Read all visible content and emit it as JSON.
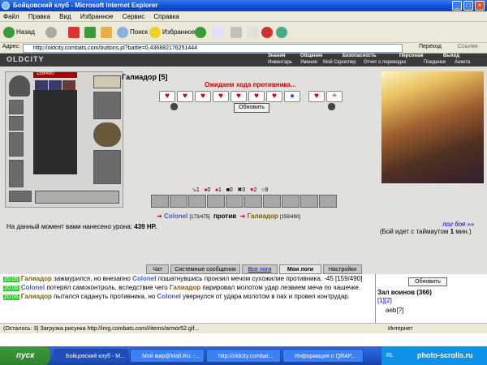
{
  "window": {
    "title": "Бойцовский клуб - Microsoft Internet Explorer",
    "min": "_",
    "max": "□",
    "close": "×"
  },
  "menu": [
    "Файл",
    "Правка",
    "Вид",
    "Избранное",
    "Сервис",
    "Справка"
  ],
  "toolbar": {
    "back": "Назад",
    "search": "Поиск",
    "favorites": "Избранное"
  },
  "address": {
    "label": "Адрес:",
    "url": "http://oldcity.combats.com/buttons.pl?battle=0.436882176251444",
    "go": "Переход",
    "links": "Ссылки"
  },
  "site": {
    "logo": "OLDCITY",
    "nav_top": [
      "Знания",
      "Общение",
      "Безопасность",
      "Персонаж",
      "Выход"
    ],
    "nav_bottom": [
      "Инвентарь",
      "Умения",
      "Мой Скроллер",
      "Отчет о переводах",
      "Поединки",
      "Анкета"
    ]
  },
  "character": {
    "hp": "159/490"
  },
  "battle": {
    "opponent_name": "Галиадор [5]",
    "waiting": "Ожидаем хода противника...",
    "refresh": "Обновить",
    "stats": [
      "1",
      "0",
      "1",
      "0",
      "0",
      "2",
      "9"
    ],
    "fighter1": "Colonel",
    "fighter1_hp": "[173/475]",
    "vs": "против",
    "fighter2": "Галиадор",
    "fighter2_hp": "[159/490]",
    "damage_label": "На данный момент вами нанесено урона:",
    "damage_value": "439 HP.",
    "log_link": "лог боя »»",
    "timeout": "(Бой идет с таймаутом",
    "timeout_value": "1",
    "timeout_unit": "мин.)"
  },
  "chat": {
    "tabs": [
      "Чат",
      "Системные сообщения",
      "Все логи",
      "Мои логи",
      "Настройки"
    ],
    "lines": [
      {
        "time": "20:05",
        "name": "Галиадор",
        "text": " зажмурился, но внезапно ",
        "name2": "Colonel",
        "text2": " пошатнувшись пронзил мечом сухожилие противника. -45 [159/490]"
      },
      {
        "time": "20:05",
        "name": "Colonel",
        "text": " потерял самоконтроль, вследствие чего ",
        "name2": "Галиадор",
        "text2": " парировал молотом удар лезвием меча по чашечке."
      },
      {
        "time": "20:05",
        "name": "Галиадор",
        "text": " пытался садануть противника, но ",
        "name2": "Colonel",
        "text2": " увернулся от удара молотом в пах и провел контрудар."
      }
    ]
  },
  "side": {
    "refresh": "Обновить",
    "hall": "Зал воинов (366)",
    "pages": "[1][2]",
    "user": "aeb[?]"
  },
  "status": {
    "text": "(Осталось: 3) Загрузка рисунка http://img.combats.com/i/items/armor52.gif...",
    "zone": "Интернет"
  },
  "taskbar": {
    "start": "пуск",
    "tasks": [
      "Бойцовский клуб - M...",
      "Мой мир@Mail.Ru: -...",
      "http://oldcity.combat...",
      "Информация о QRAP..."
    ],
    "lang": "RL",
    "watermark": "photo-scrolls.ru"
  }
}
